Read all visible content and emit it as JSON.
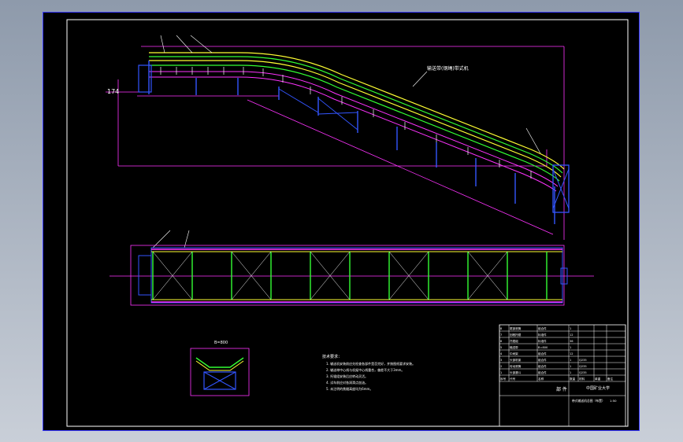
{
  "colors": {
    "frame": "#3a3aff",
    "border": "#ffffff",
    "dim": "#ff33ff",
    "belt_green": "#33ff33",
    "belt_yellow": "#ffff33",
    "structure_blue": "#3355ff",
    "text_white": "#ffffff"
  },
  "elevation_view": {
    "height_label": "174",
    "belt_label": "输送带(钢绳)带式机"
  },
  "section_view": {
    "label_top": "B=800"
  },
  "notes": {
    "title": "技术要求：",
    "lines": [
      "1. 输送机安装前应先检查各部件是否完好，并按图纸要求安装。",
      "2. 输送带中心线与机架中心线重合，偏差不大于3mm。",
      "3. 托辊组安装后应转动灵活。",
      "4. 试车前应对各润滑点加油。",
      "5. 未注明的焦缝高度均为6mm。"
    ]
  },
  "title_block": {
    "rows": [
      [
        "1",
        "头部漏斗",
        "组合件",
        "1",
        "Q235",
        "",
        ""
      ],
      [
        "2",
        "传动滚筒",
        "组合件",
        "1",
        "Q235",
        "",
        ""
      ],
      [
        "3",
        "头部机架",
        "组合件",
        "1",
        "Q235",
        "",
        ""
      ],
      [
        "4",
        "中间架",
        "组合件",
        "12",
        "",
        "",
        ""
      ],
      [
        "5",
        "输送带",
        "B=800",
        "1",
        "",
        "",
        ""
      ],
      [
        "6",
        "托辊组",
        "标准件",
        "36",
        "",
        "",
        ""
      ],
      [
        "7",
        "回程托辊",
        "标准件",
        "12",
        "",
        "",
        ""
      ],
      [
        "8",
        "尾部滚筒",
        "组合件",
        "1",
        "",
        "",
        ""
      ]
    ],
    "header": [
      "序号",
      "代号",
      "名称",
      "数量",
      "材料",
      "单重",
      "备注"
    ],
    "company": "中国矿业大学",
    "parts_label": "部  件",
    "drawing_name": "带式输送机总图（布置）",
    "scale": "1:50"
  }
}
